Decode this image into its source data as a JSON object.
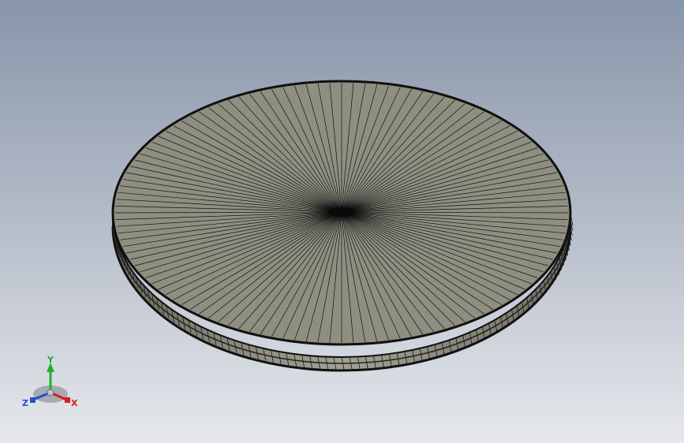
{
  "viewport": {
    "background_top": "#8896ab",
    "background_bottom": "#e6e8ec"
  },
  "model": {
    "part": "disc",
    "face_color": "#8f8f81",
    "edge_color": "#111111",
    "mesh_spokes": 120,
    "rim_segments": 90
  },
  "triad": {
    "x_label": "X",
    "y_label": "Y",
    "z_label": "Z",
    "x_color": "#d02020",
    "y_color": "#20b030",
    "z_color": "#2050d0"
  }
}
